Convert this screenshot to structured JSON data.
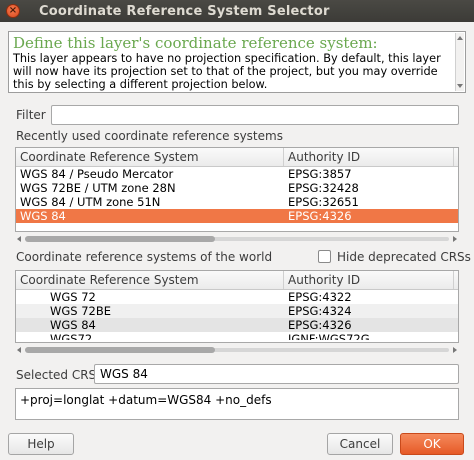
{
  "window": {
    "title": "Coordinate Reference System Selector",
    "close_glyph": "×"
  },
  "message": {
    "header": "Define this layer's coordinate reference system:",
    "body": "This layer appears to have no projection specification. By default, this layer will now have its projection set to that of the project, but you may override this by selecting a different projection below."
  },
  "filter": {
    "label": "Filter",
    "value": ""
  },
  "recent": {
    "section_label": "Recently used coordinate reference systems",
    "columns": [
      "Coordinate Reference System",
      "Authority ID"
    ],
    "rows": [
      {
        "crs": "WGS 84 / Pseudo Mercator",
        "authority": "EPSG:3857"
      },
      {
        "crs": "WGS 72BE / UTM zone 28N",
        "authority": "EPSG:32428"
      },
      {
        "crs": "WGS 84 / UTM zone 51N",
        "authority": "EPSG:32651"
      },
      {
        "crs": "WGS 84",
        "authority": "EPSG:4326"
      }
    ]
  },
  "world": {
    "section_label": "Coordinate reference systems of the world",
    "hide_deprecated_label": "Hide deprecated CRSs",
    "hide_deprecated_checked": false,
    "columns": [
      "Coordinate Reference System",
      "Authority ID"
    ],
    "rows": [
      {
        "crs": "WGS 72",
        "authority": "EPSG:4322"
      },
      {
        "crs": "WGS 72BE",
        "authority": "EPSG:4324"
      },
      {
        "crs": "WGS 84",
        "authority": "EPSG:4326"
      },
      {
        "crs": "WGS72",
        "authority": "IGNF:WGS72G"
      }
    ]
  },
  "selected": {
    "label": "Selected CRS:",
    "value": "WGS 84"
  },
  "proj_string": "+proj=longlat +datum=WGS84 +no_defs",
  "buttons": {
    "help": "Help",
    "cancel": "Cancel",
    "ok": "OK"
  },
  "colors": {
    "accent": "#f07746",
    "header_green": "#6aa84f",
    "titlebar": "#3c3b37"
  },
  "icons": {
    "close": "close-icon",
    "scroll_up": "arrow-up-icon",
    "scroll_down": "arrow-down-icon",
    "scroll_left": "arrow-left-icon",
    "scroll_right": "arrow-right-icon"
  }
}
